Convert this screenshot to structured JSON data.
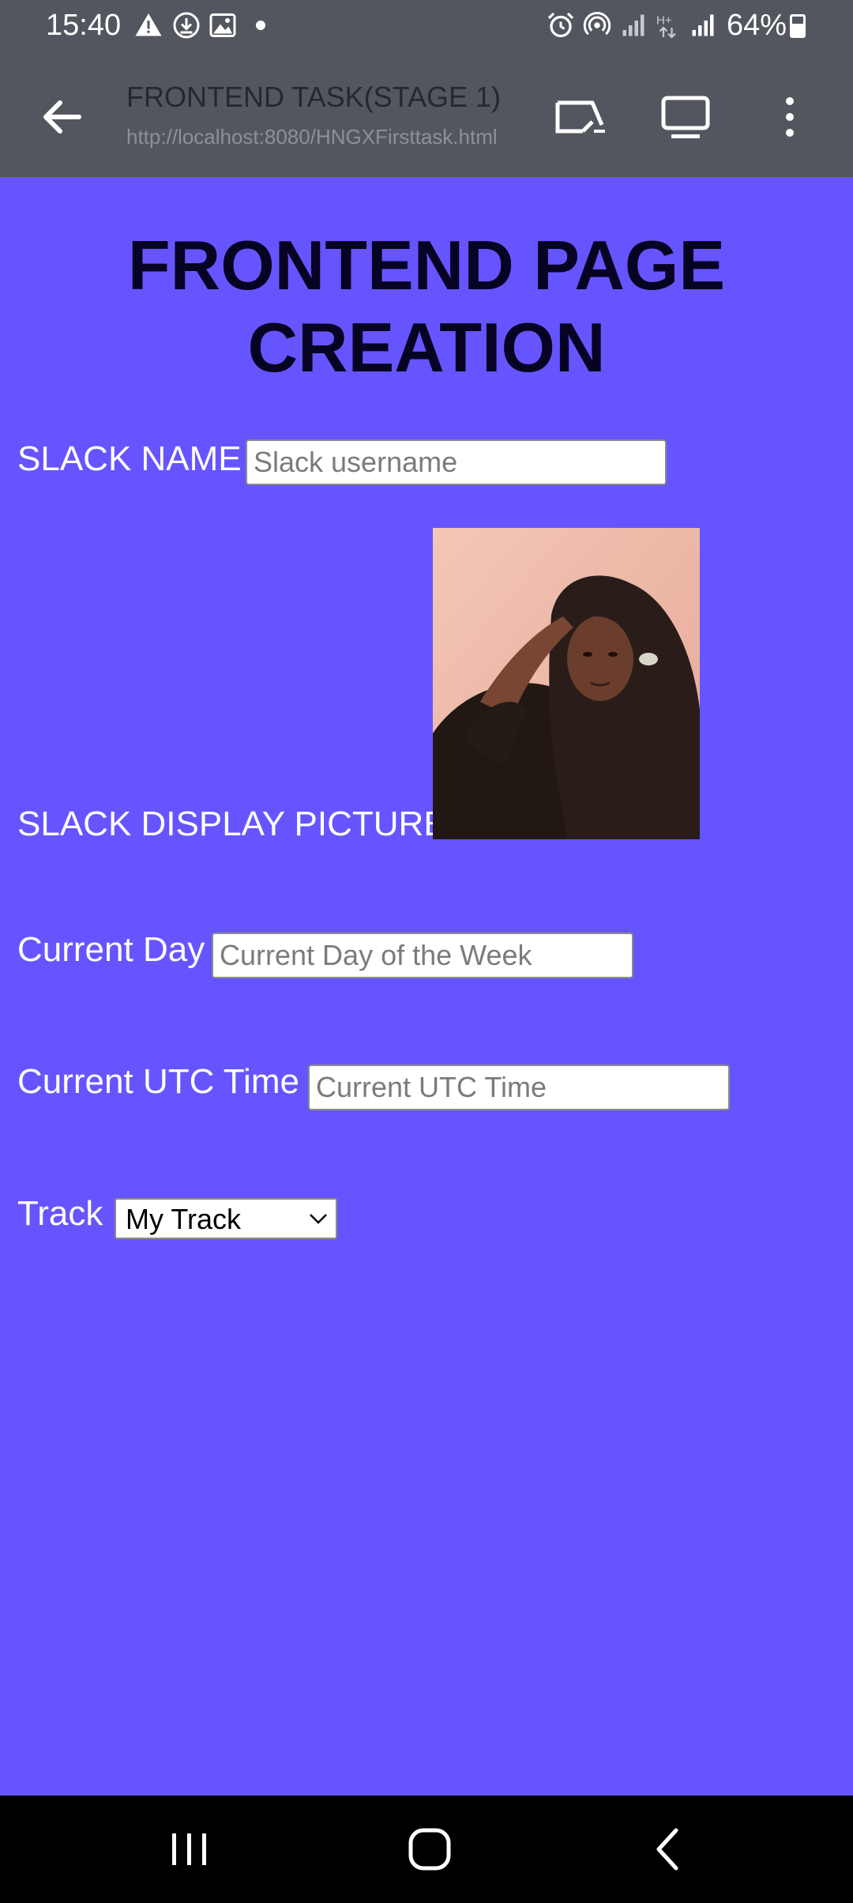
{
  "status_bar": {
    "time": "15:40",
    "battery": "64%",
    "left_icons": [
      "warning-icon",
      "download-icon",
      "image-icon",
      "dot-icon"
    ],
    "right_icons": [
      "alarm-icon",
      "hotspot-icon",
      "signal-icon",
      "data-icon",
      "signal-icon",
      "battery-icon"
    ]
  },
  "toolbar": {
    "title": "FRONTEND TASK(STAGE 1)",
    "url": "http://localhost:8080/HNGXFirsttask.html",
    "icons": [
      "back-arrow-icon",
      "cast-icon",
      "desktop-icon",
      "more-vert-icon"
    ]
  },
  "page": {
    "heading": "FRONTEND PAGE CREATION",
    "slack_name": {
      "label": "SLACK NAME",
      "placeholder": "Slack username"
    },
    "display_picture": {
      "label": "SLACK DISPLAY PICTURE"
    },
    "current_day": {
      "label": "Current Day",
      "placeholder": "Current Day of the Week"
    },
    "utc_time": {
      "label": "Current UTC Time",
      "placeholder": "Current UTC Time"
    },
    "track": {
      "label": "Track",
      "selected": "My Track"
    }
  },
  "nav_bar": {
    "icons": [
      "recents-icon",
      "home-icon",
      "back-icon"
    ]
  },
  "colors": {
    "page_background": "#6655ff",
    "heading_text": "#070322",
    "chrome_background": "#54565f"
  }
}
